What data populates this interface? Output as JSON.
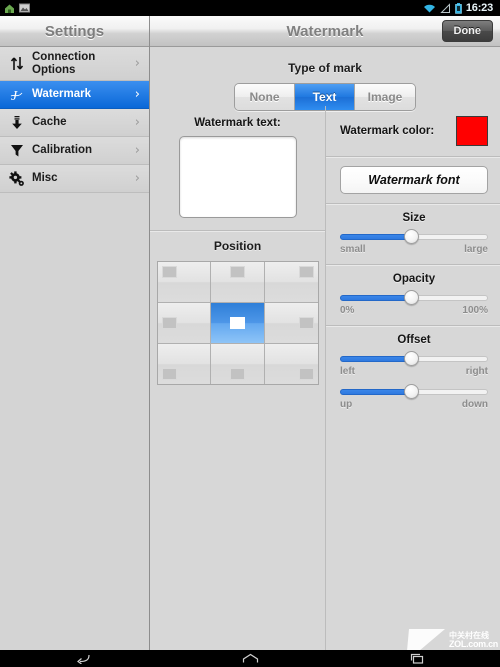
{
  "statusbar": {
    "clock": "16:23",
    "left_icons": [
      "home-notification-icon",
      "screenshot-notification-icon"
    ],
    "right_icons": [
      "wifi-icon",
      "signal-icon",
      "battery-icon"
    ]
  },
  "sidebar": {
    "title": "Settings",
    "items": [
      {
        "label": "Connection Options",
        "icon": "updown-arrows-icon",
        "chevron": "›",
        "selected": false
      },
      {
        "label": "Watermark",
        "icon": "script-letter-icon",
        "chevron": "›",
        "selected": true
      },
      {
        "label": "Cache",
        "icon": "download-arrow-icon",
        "chevron": "›",
        "selected": false
      },
      {
        "label": "Calibration",
        "icon": "funnel-icon",
        "chevron": "›",
        "selected": false
      },
      {
        "label": "Misc",
        "icon": "gear-icon",
        "chevron": "›",
        "selected": false
      }
    ]
  },
  "header": {
    "title": "Watermark",
    "done_label": "Done"
  },
  "type_of_mark": {
    "label": "Type of mark",
    "options": [
      "None",
      "Text",
      "Image"
    ],
    "selected": "Text"
  },
  "watermark_text": {
    "label": "Watermark text:",
    "value": "",
    "placeholder": ""
  },
  "position": {
    "label": "Position",
    "cells": [
      {
        "h": "left",
        "v": "top",
        "selected": false
      },
      {
        "h": "center",
        "v": "top",
        "selected": false
      },
      {
        "h": "right",
        "v": "top",
        "selected": false
      },
      {
        "h": "left",
        "v": "middle",
        "selected": false
      },
      {
        "h": "center",
        "v": "middle",
        "selected": true
      },
      {
        "h": "right",
        "v": "middle",
        "selected": false
      },
      {
        "h": "left",
        "v": "bottom",
        "selected": false
      },
      {
        "h": "center",
        "v": "bottom",
        "selected": false
      },
      {
        "h": "right",
        "v": "bottom",
        "selected": false
      }
    ],
    "selected_index": 4
  },
  "color": {
    "label": "Watermark color:",
    "value": "#FF0000"
  },
  "font": {
    "button_label": "Watermark font"
  },
  "size": {
    "title": "Size",
    "min_label": "small",
    "max_label": "large",
    "percent": 48
  },
  "opacity": {
    "title": "Opacity",
    "min_label": "0%",
    "max_label": "100%",
    "percent": 48
  },
  "offset": {
    "title": "Offset",
    "horizontal": {
      "min_label": "left",
      "max_label": "right",
      "percent": 48
    },
    "vertical": {
      "min_label": "up",
      "max_label": "down",
      "percent": 48
    }
  },
  "navbar": {
    "buttons": [
      "back-icon",
      "home-icon",
      "recents-icon"
    ]
  },
  "watermark_logo": {
    "cn": "中关村在线",
    "en": "ZOL.com.cn"
  }
}
